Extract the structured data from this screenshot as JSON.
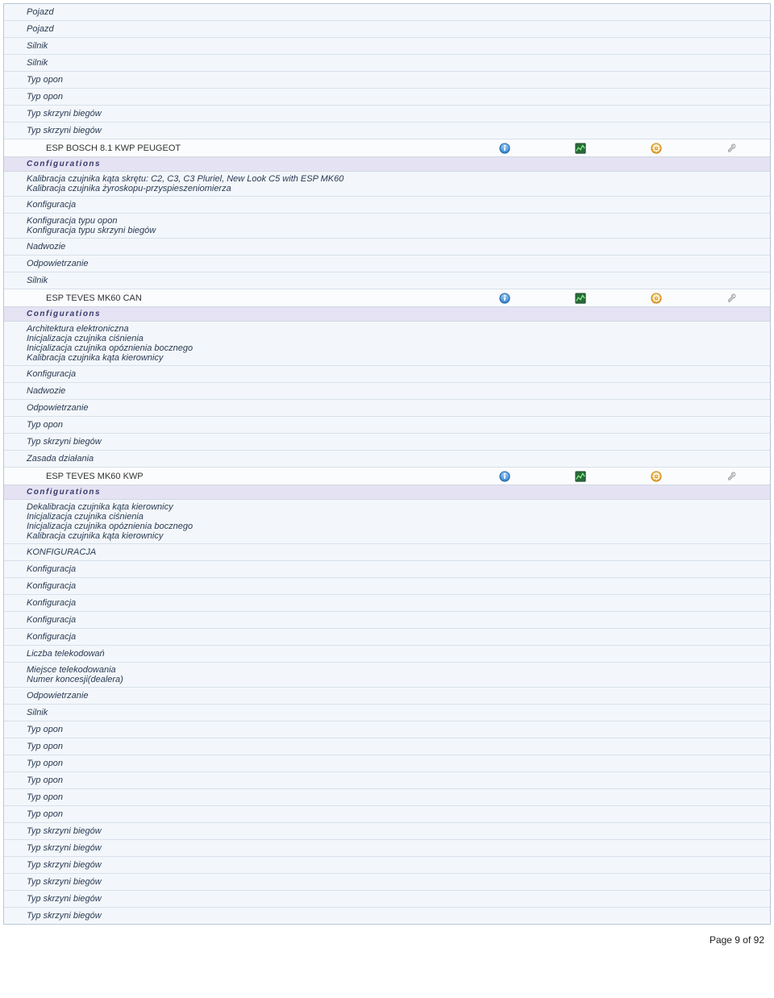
{
  "pre_items": [
    "Pojazd",
    "Pojazd",
    "Silnik",
    "Silnik",
    "Typ opon",
    "Typ opon",
    "Typ skrzyni biegów",
    "Typ skrzyni biegów"
  ],
  "modules": [
    {
      "title": "ESP BOSCH 8.1 KWP PEUGEOT",
      "config_label": "Configurations",
      "sub_lines": [
        "Kalibracja czujnika kąta skrętu: C2, C3, C3 Pluriel, New Look C5 with ESP MK60",
        "Kalibracja czujnika żyroskopu-przyspieszeniomierza"
      ],
      "items": [
        "Konfiguracja"
      ],
      "sub_lines2": [
        "Konfiguracja typu opon",
        "Konfiguracja typu skrzyni biegów"
      ],
      "items2": [
        "Nadwozie",
        "Odpowietrzanie",
        "Silnik"
      ]
    },
    {
      "title": "ESP TEVES MK60 CAN",
      "config_label": "Configurations",
      "sub_lines": [
        "Architektura elektroniczna",
        "Inicjalizacja czujnika ciśnienia",
        "Inicjalizacja czujnika opóznienia bocznego",
        "Kalibracja czujnika kąta kierownicy"
      ],
      "items": [
        "Konfiguracja",
        "Nadwozie",
        "Odpowietrzanie",
        "Typ opon",
        "Typ skrzyni biegów",
        "Zasada działania"
      ],
      "sub_lines2": [],
      "items2": []
    },
    {
      "title": "ESP TEVES MK60 KWP",
      "config_label": "Configurations",
      "sub_lines": [
        "Dekalibracja czujnika kąta kierownicy",
        "Inicjalizacja czujnika ciśnienia",
        "Inicjalizacja czujnika opóznienia bocznego",
        "Kalibracja czujnika kąta kierownicy"
      ],
      "items": [
        "KONFIGURACJA",
        "Konfiguracja",
        "Konfiguracja",
        "Konfiguracja",
        "Konfiguracja",
        "Konfiguracja",
        "Liczba telekodowań"
      ],
      "sub_lines2": [
        "Miejsce telekodowania",
        "Numer koncesji(dealera)"
      ],
      "items2": [
        "Odpowietrzanie",
        "Silnik",
        "Typ opon",
        "Typ opon",
        "Typ opon",
        "Typ opon",
        "Typ opon",
        "Typ opon",
        "Typ skrzyni biegów",
        "Typ skrzyni biegów",
        "Typ skrzyni biegów",
        "Typ skrzyni biegów",
        "Typ skrzyni biegów",
        "Typ skrzyni biegów"
      ]
    }
  ],
  "footer": "Page 9 of 92",
  "icons": {
    "info": "info",
    "graph": "graph",
    "gear": "gear",
    "wrench": "wrench"
  }
}
